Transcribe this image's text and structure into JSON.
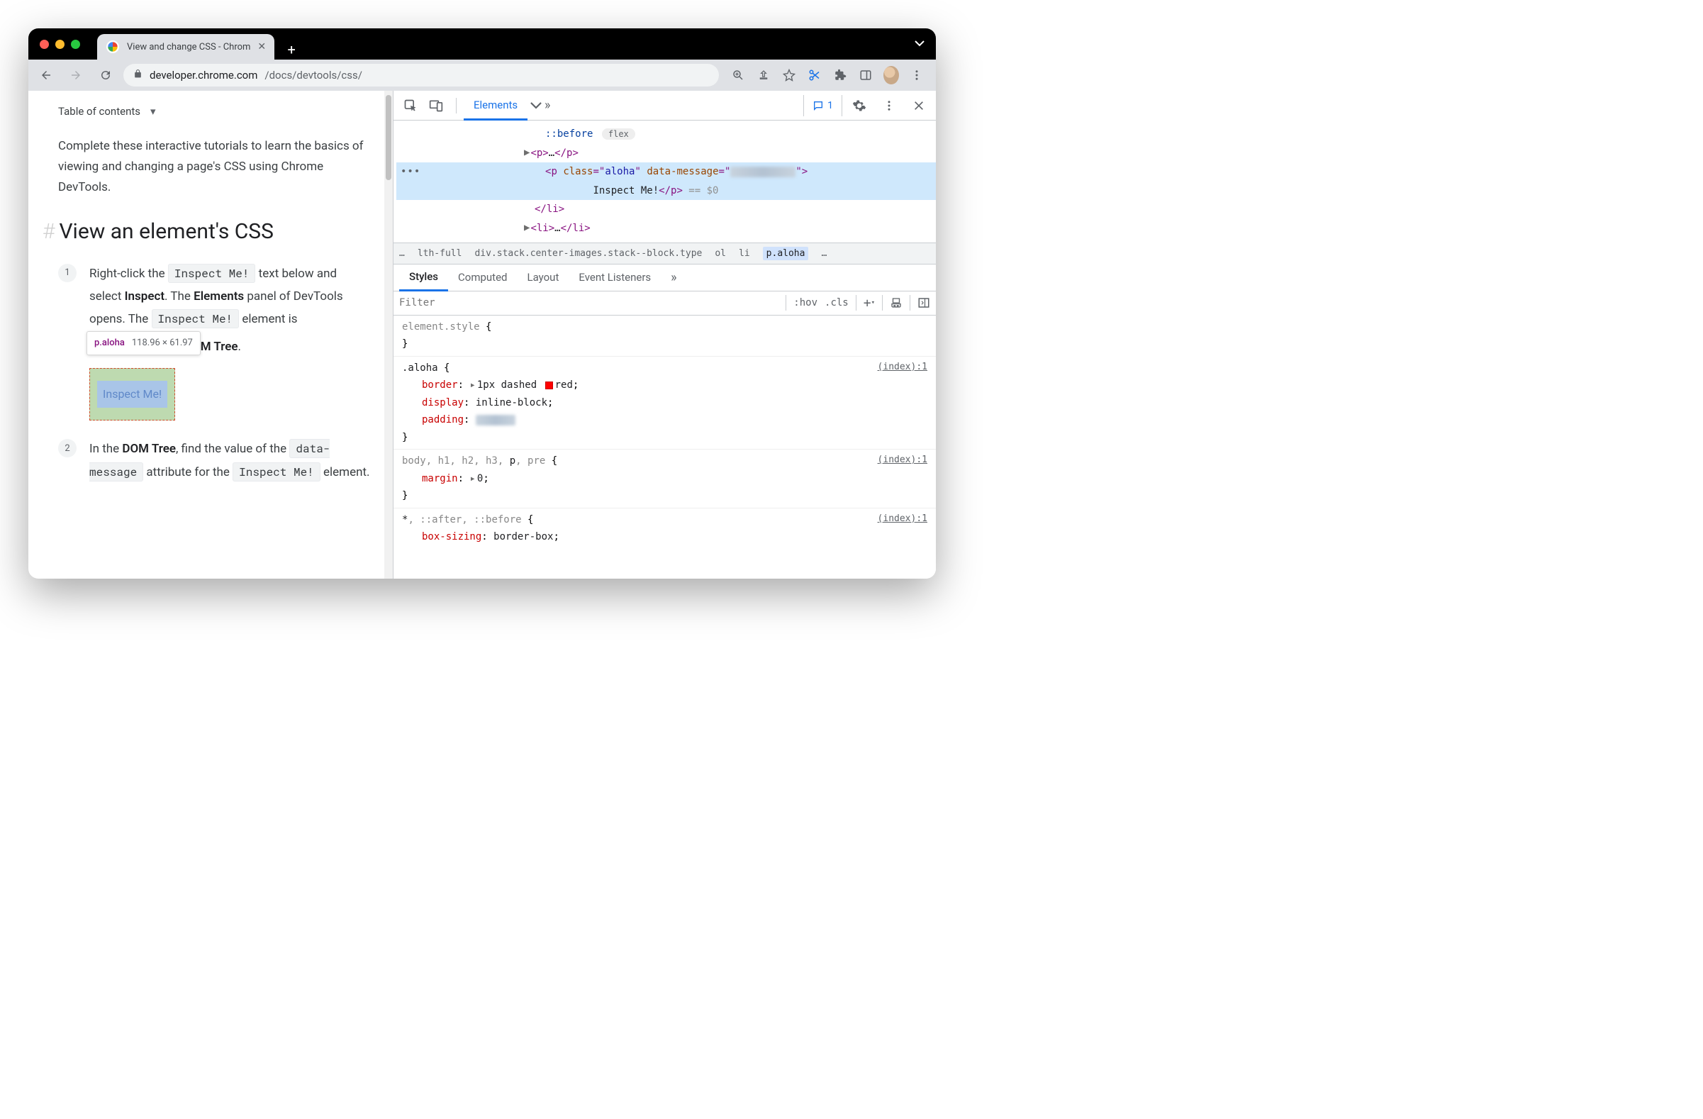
{
  "tab": {
    "title": "View and change CSS - Chrom"
  },
  "url": {
    "domain": "developer.chrome.com",
    "path": "/docs/devtools/css/"
  },
  "page": {
    "toc_label": "Table of contents",
    "intro": "Complete these interactive tutorials to learn the basics of viewing and changing a page's CSS using Chrome DevTools.",
    "h2": "View an element's CSS",
    "step1_a": "Right-click the ",
    "step1_code1": "Inspect Me!",
    "step1_b": " text below and select ",
    "step1_inspect": "Inspect",
    "step1_c": ". The ",
    "step1_elements": "Elements",
    "step1_d": " panel of DevTools opens. The ",
    "step1_code2": "Inspect Me!",
    "step1_e": " element is ",
    "step1_domtree_end": "OM Tree",
    "step2_a": "In the ",
    "step2_domtree": "DOM Tree",
    "step2_b": ", find the value of the ",
    "step2_code1": "data-message",
    "step2_c": " attribute for the ",
    "step2_code2": "Inspect Me!",
    "step2_d": " element.",
    "inspect_me_text": "Inspect Me!",
    "tooltip_selector": "p.aloha",
    "tooltip_dims": "118.96 × 61.97"
  },
  "devtools": {
    "main_tab": "Elements",
    "issue_count": "1",
    "dom": {
      "before_pseudo": "::before",
      "flex_badge": "flex",
      "p_open": "<p>",
      "p_ellipsis": "…",
      "p_close": "</p>",
      "sel_open_lt": "<",
      "sel_tag": "p",
      "sel_attr1_name": "class",
      "sel_attr1_val": "aloha",
      "sel_attr2_name": "data-message",
      "sel_close_gt": ">",
      "sel_text": "Inspect Me!",
      "sel_closetag": "</p>",
      "eq_dollar": " == $0",
      "li_close": "</li>",
      "li_open": "<li>",
      "li_ellipsis": "…",
      "li_close2": "</li>"
    },
    "crumbs": {
      "ellipsis": "…",
      "c1": "lth-full",
      "c2": "div.stack.center-images.stack--block.type",
      "c3": "ol",
      "c4": "li",
      "c5": "p.aloha",
      "end_ellipsis": "…"
    },
    "styles_tabs": {
      "styles": "Styles",
      "computed": "Computed",
      "layout": "Layout",
      "listeners": "Event Listeners"
    },
    "filter": {
      "placeholder": "Filter",
      "hov": ":hov",
      "cls": ".cls"
    },
    "rules": {
      "r0_sel": "element.style",
      "r1_sel": ".aloha",
      "r1_link": "(index):1",
      "r1_p1_name": "border",
      "r1_p1_val": "1px dashed ",
      "r1_p1_color": "red",
      "r1_p2_name": "display",
      "r1_p2_val": "inline-block",
      "r1_p3_name": "padding",
      "r2_sel_pre": "body, h1, h2, h3, ",
      "r2_sel_match": "p",
      "r2_sel_post": ", pre",
      "r2_link": "(index):1",
      "r2_p1_name": "margin",
      "r2_p1_val": "0",
      "r3_sel": "*, ::after, ::before",
      "r3_link": "(index):1",
      "r3_p1_name": "box-sizing",
      "r3_p1_val": "border-box"
    }
  }
}
